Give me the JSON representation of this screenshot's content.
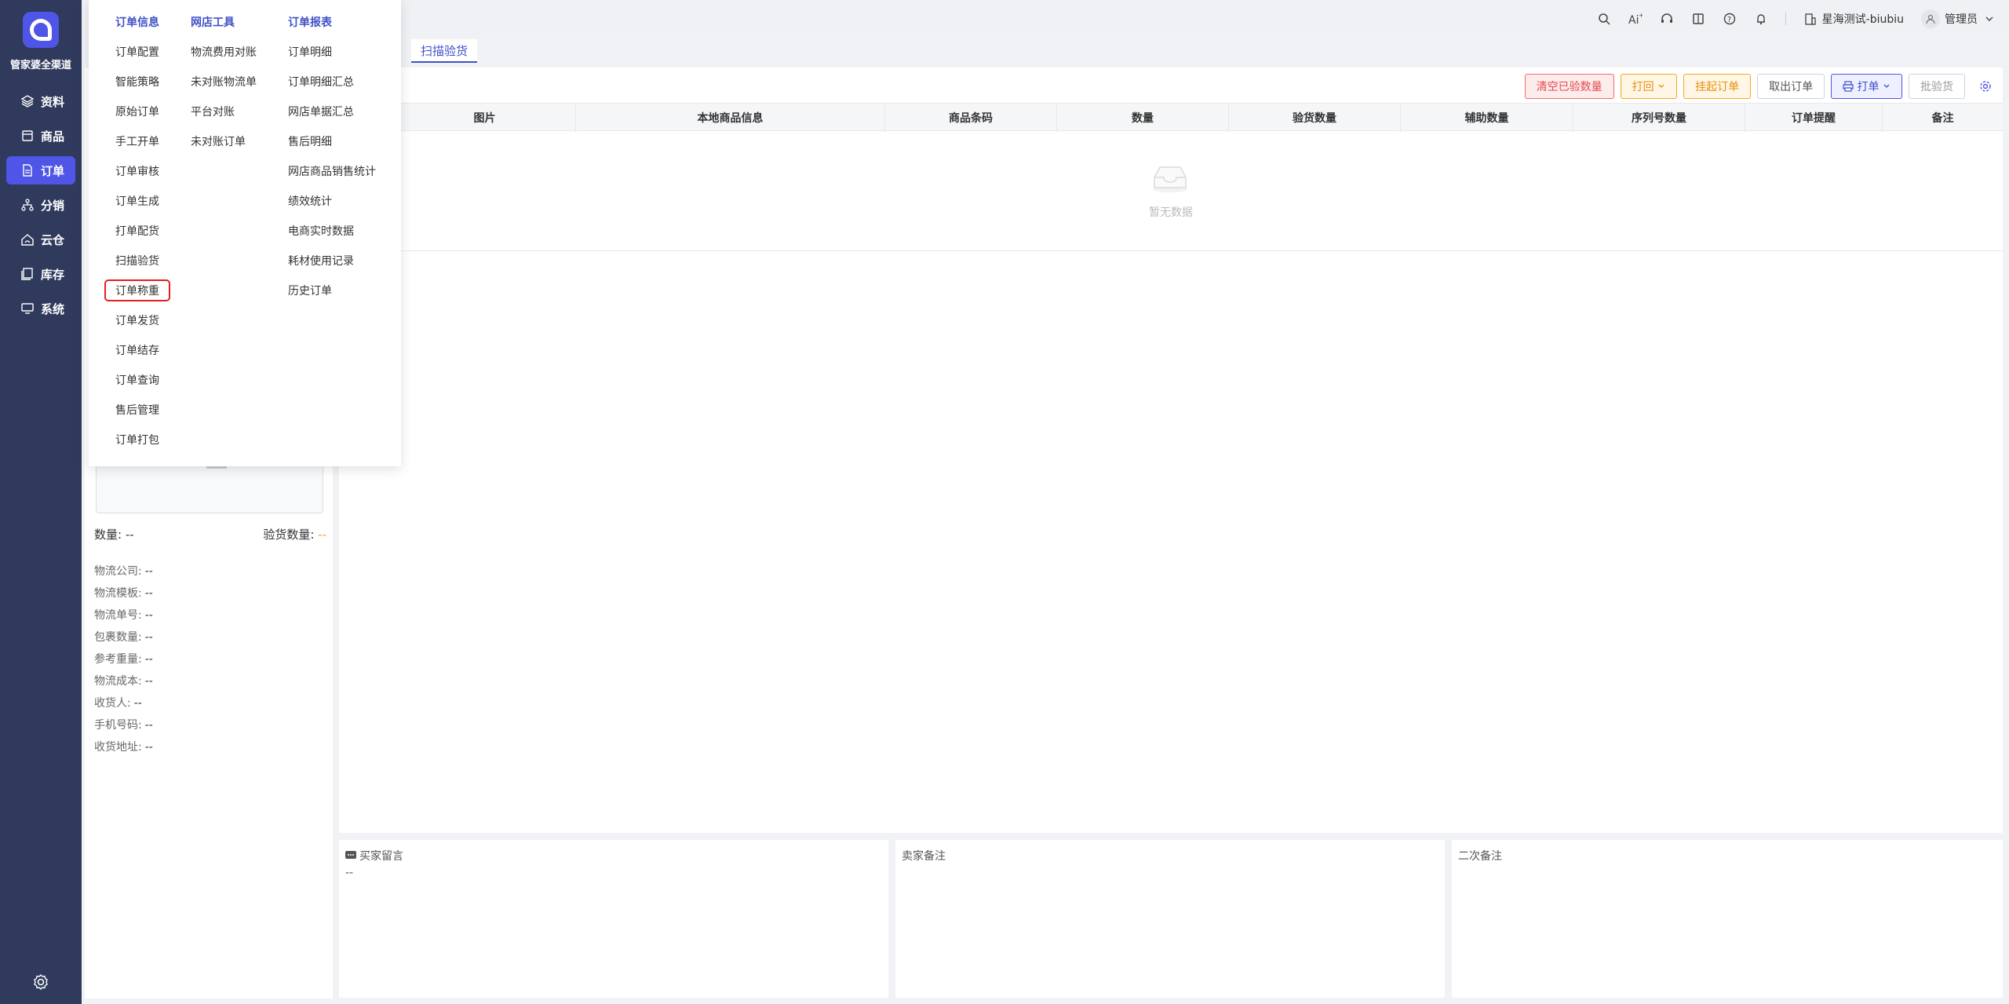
{
  "brand": {
    "name": "管家婆全渠道"
  },
  "nav": [
    {
      "label": "资料",
      "icon": "layers-icon"
    },
    {
      "label": "商品",
      "icon": "box-icon"
    },
    {
      "label": "订单",
      "icon": "document-icon",
      "active": true
    },
    {
      "label": "分销",
      "icon": "network-icon"
    },
    {
      "label": "云仓",
      "icon": "cloud-warehouse-icon"
    },
    {
      "label": "库存",
      "icon": "inventory-icon"
    },
    {
      "label": "系统",
      "icon": "monitor-icon"
    }
  ],
  "topbar": {
    "account": "星海测试-biubiu",
    "user": "管理员"
  },
  "tabs": {
    "active": "扫描验货"
  },
  "menu": {
    "col1": {
      "heading": "订单信息",
      "items": [
        "订单配置",
        "智能策略",
        "原始订单",
        "手工开单",
        "订单审核",
        "订单生成",
        "打单配货",
        "扫描验货",
        "订单称重",
        "订单发货",
        "订单结存",
        "订单查询",
        "售后管理",
        "订单打包"
      ]
    },
    "col2": {
      "heading": "网店工具",
      "items": [
        "物流费用对账",
        "未对账物流单",
        "平台对账",
        "未对账订单"
      ]
    },
    "col3": {
      "heading": "订单报表",
      "items": [
        "订单明细",
        "订单明细汇总",
        "网店单据汇总",
        "售后明细",
        "网店商品销售统计",
        "绩效统计",
        "电商实时数据",
        "耗材使用记录",
        "历史订单"
      ]
    },
    "highlighted": "订单称重"
  },
  "left": {
    "qty_label": "数量:",
    "qty_value": "--",
    "checked_label": "验货数量:",
    "checked_value": "--",
    "info": [
      {
        "label": "物流公司:",
        "value": "--"
      },
      {
        "label": "物流模板:",
        "value": "--"
      },
      {
        "label": "物流单号:",
        "value": "--"
      },
      {
        "label": "包裹数量:",
        "value": "--"
      },
      {
        "label": "参考重量:",
        "value": "--"
      },
      {
        "label": "物流成本:",
        "value": "--"
      },
      {
        "label": "收货人:",
        "value": "--"
      },
      {
        "label": "手机号码:",
        "value": "--"
      },
      {
        "label": "收货地址:",
        "value": "--"
      }
    ]
  },
  "toolbar": {
    "clear_checked": "清空已验数量",
    "reprint": "打回",
    "hold_order": "挂起订单",
    "cancel_order": "取出订单",
    "print": "打单",
    "batch_check": "批验货"
  },
  "table": {
    "columns": [
      "图片",
      "本地商品信息",
      "商品条码",
      "数量",
      "验货数量",
      "辅助数量",
      "序列号数量",
      "订单提醒",
      "备注"
    ],
    "empty_text": "暂无数据"
  },
  "notes": {
    "buyer_label": "买家留言",
    "buyer_value": "--",
    "seller_label": "卖家备注",
    "second_label": "二次备注"
  }
}
